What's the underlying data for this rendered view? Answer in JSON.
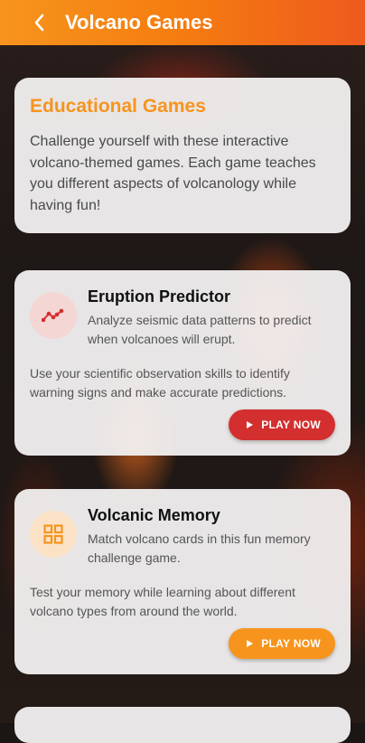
{
  "app": {
    "title": "Volcano Games"
  },
  "intro": {
    "title": "Educational Games",
    "text": "Challenge yourself with these interactive volcano-themed games. Each game teaches you different aspects of volcanology while having fun!"
  },
  "games": [
    {
      "title": "Eruption Predictor",
      "subtitle": "Analyze seismic data patterns to predict when volcanoes will erupt.",
      "description": "Use your scientific observation skills to identify warning signs and make accurate predictions.",
      "button_label": "PLAY NOW",
      "icon": "trending-line-icon",
      "accent": "#d32f2f",
      "icon_bg": "#f4d6d4"
    },
    {
      "title": "Volcanic Memory",
      "subtitle": "Match volcano cards in this fun memory challenge game.",
      "description": "Test your memory while learning about different volcano types from around the world.",
      "button_label": "PLAY NOW",
      "icon": "grid-icon",
      "accent": "#f7941d",
      "icon_bg": "#fbe2c6"
    }
  ],
  "colors": {
    "appbar_start": "#f7941d",
    "appbar_end": "#ee5a1e",
    "intro_title": "#f7941d"
  }
}
